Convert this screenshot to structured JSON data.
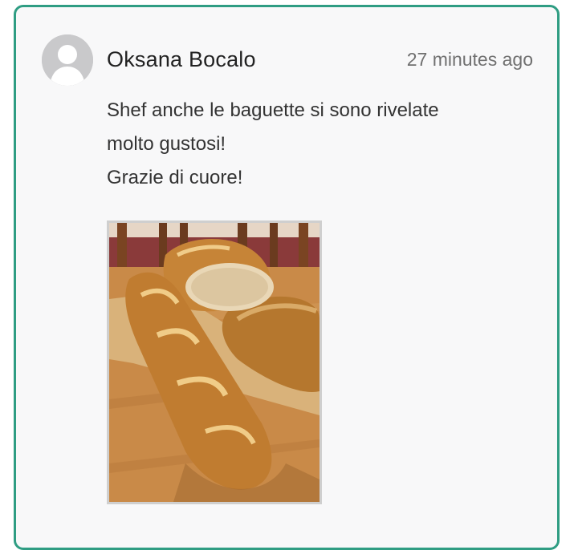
{
  "comment": {
    "author": "Oksana Bocalo",
    "timestamp": "27 minutes ago",
    "lines": [
      "Shef anche le baguette si sono rivelate",
      "molto gustosi!",
      "Grazie di cuore!"
    ],
    "avatar_icon": "default-user-avatar-icon",
    "attachment_icon": "baguette-photo"
  },
  "colors": {
    "card_border": "#2f9d83",
    "card_bg": "#f8f8f9",
    "author_text": "#222222",
    "timestamp_text": "#707070"
  }
}
